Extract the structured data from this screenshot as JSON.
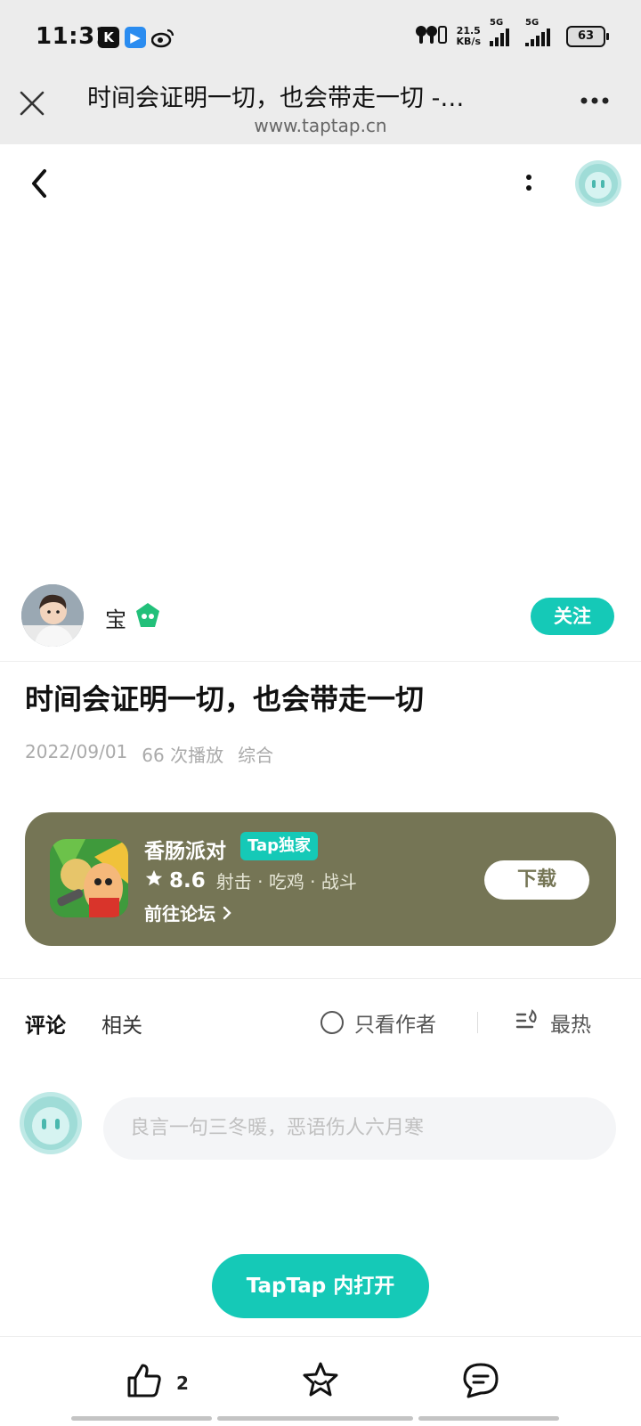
{
  "status_bar": {
    "time": "11:31",
    "app_icons": [
      "k-app-icon",
      "camera-app-icon",
      "weibo-icon"
    ],
    "net_speed_value": "21.5",
    "net_speed_unit": "KB/s",
    "signal1_label": "5G",
    "signal2_label": "5G",
    "battery": "63"
  },
  "browser": {
    "title": "时间会证明一切，也会带走一切 -…",
    "url": "www.taptap.cn"
  },
  "author": {
    "name": "宝",
    "follow_label": "关注"
  },
  "post": {
    "title": "时间会证明一切，也会带走一切",
    "date": "2022/09/01",
    "plays": "66 次播放",
    "category": "综合"
  },
  "game": {
    "name": "香肠派对",
    "badge": "Tap独家",
    "rating": "8.6",
    "tags": "射击 · 吃鸡 · 战斗",
    "forum_link": "前往论坛",
    "download_label": "下载"
  },
  "comments": {
    "tab_comments": "评论",
    "tab_related": "相关",
    "author_only_label": "只看作者",
    "sort_label": "最热",
    "input_placeholder": "良言一句三冬暖，恶语伤人六月寒"
  },
  "open_app_label": "TapTap 内打开",
  "actions": {
    "like_count": "2"
  },
  "colors": {
    "accent": "#15c9b7",
    "game_card": "#757555"
  }
}
